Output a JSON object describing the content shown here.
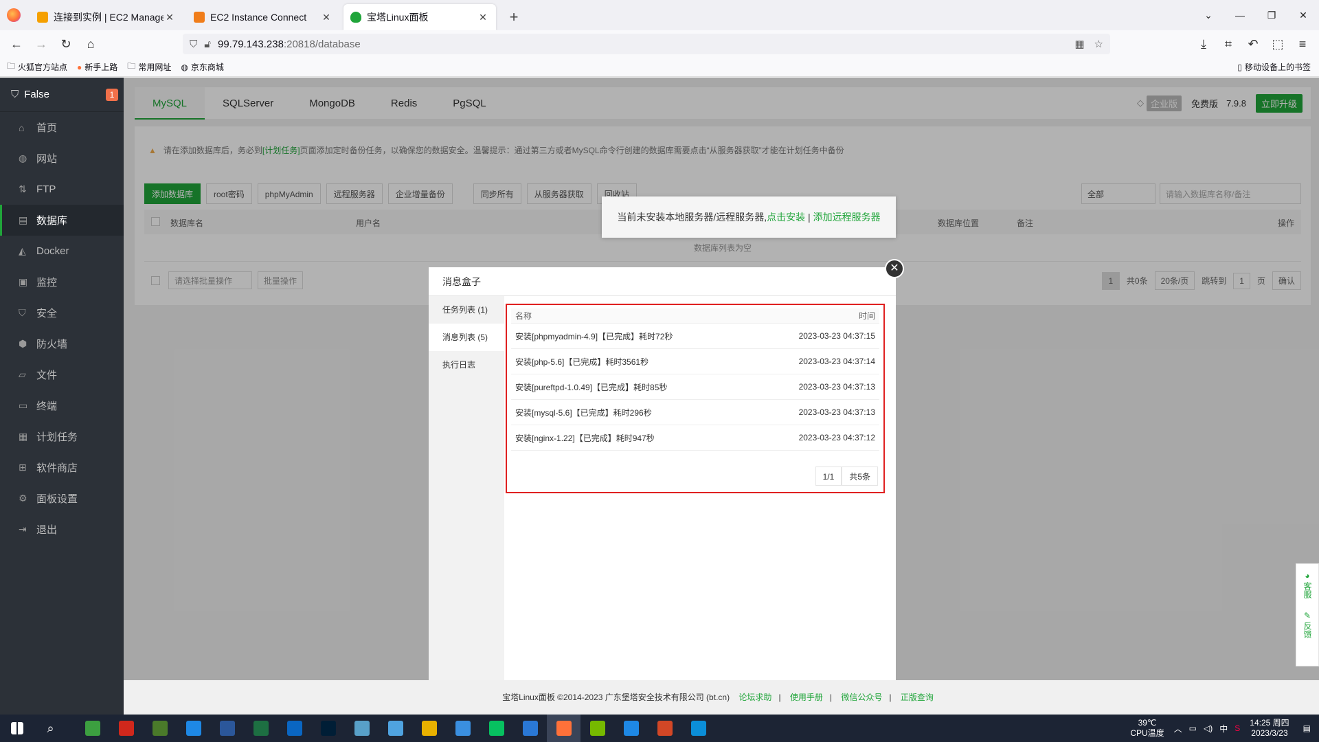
{
  "browser": {
    "tabs": [
      {
        "title": "连接到实例 | EC2 Managemen",
        "color": "#f5a000"
      },
      {
        "title": "EC2 Instance Connect",
        "color": "#f07d1a"
      },
      {
        "title": "宝塔Linux面板",
        "color": "#20a53a"
      }
    ],
    "url_host": "99.79.143.238",
    "url_path": ":20818/database",
    "bookmarks": [
      "火狐官方站点",
      "新手上路",
      "常用网址",
      "京东商城"
    ],
    "mobile_bookmarks": "移动设备上的书签"
  },
  "sidebar": {
    "title": "False",
    "badge": "1",
    "items": [
      {
        "label": "首页",
        "icon": "⌂"
      },
      {
        "label": "网站",
        "icon": "◍"
      },
      {
        "label": "FTP",
        "icon": "⇅"
      },
      {
        "label": "数据库",
        "icon": "▤"
      },
      {
        "label": "Docker",
        "icon": "◭"
      },
      {
        "label": "监控",
        "icon": "▣"
      },
      {
        "label": "安全",
        "icon": "⛉"
      },
      {
        "label": "防火墙",
        "icon": "⬢"
      },
      {
        "label": "文件",
        "icon": "▱"
      },
      {
        "label": "终端",
        "icon": "▭"
      },
      {
        "label": "计划任务",
        "icon": "▦"
      },
      {
        "label": "软件商店",
        "icon": "⊞"
      },
      {
        "label": "面板设置",
        "icon": "⚙"
      },
      {
        "label": "退出",
        "icon": "⇥"
      }
    ]
  },
  "db_tabs": [
    "MySQL",
    "SQLServer",
    "MongoDB",
    "Redis",
    "PgSQL"
  ],
  "edition": {
    "enterprise": "企业版",
    "free": "免费版",
    "version": "7.9.8",
    "upgrade": "立即升级"
  },
  "warning": {
    "pre": "请在添加数据库后，务必到",
    "link": "[计划任务]",
    "post": "页面添加定时备份任务，以确保您的数据安全。温馨提示：通过第三方或者MySQL命令行创建的数据库需要点击“从服务器获取”才能在计划任务中备份"
  },
  "buttons": [
    "添加数据库",
    "root密码",
    "phpMyAdmin",
    "远程服务器",
    "企业增量备份",
    "同步所有",
    "从服务器获取",
    "回收站"
  ],
  "filter": {
    "select": "全部",
    "search_placeholder": "请输入数据库名称/备注"
  },
  "table_headers": [
    "数据库名",
    "用户名",
    "数据库位置",
    "备注",
    "操作"
  ],
  "empty_text": "数据库列表为空",
  "batch": {
    "select": "请选择批量操作",
    "btn": "批量操作"
  },
  "pager": {
    "page": "1",
    "total": "共0条",
    "per": "20条/页",
    "jump": "跳转到",
    "page_num": "1",
    "page_unit": "页",
    "confirm": "确认"
  },
  "tip": {
    "text": "当前未安装本地服务器/远程服务器,",
    "install": "点击安装",
    "sep": " | ",
    "remote": "添加远程服务器"
  },
  "modal": {
    "title": "消息盒子",
    "nav": [
      "任务列表 (1)",
      "消息列表 (5)",
      "执行日志"
    ],
    "col_name": "名称",
    "col_time": "时间",
    "rows": [
      {
        "name": "安装[phpmyadmin-4.9]【已完成】耗时72秒",
        "time": "2023-03-23 04:37:15"
      },
      {
        "name": "安装[php-5.6]【已完成】耗时3561秒",
        "time": "2023-03-23 04:37:14"
      },
      {
        "name": "安装[pureftpd-1.0.49]【已完成】耗时85秒",
        "time": "2023-03-23 04:37:13"
      },
      {
        "name": "安装[mysql-5.6]【已完成】耗时296秒",
        "time": "2023-03-23 04:37:13"
      },
      {
        "name": "安装[nginx-1.22]【已完成】耗时947秒",
        "time": "2023-03-23 04:37:12"
      }
    ],
    "page": "1/1",
    "total": "共5条"
  },
  "footer": {
    "copyright": "宝塔Linux面板 ©2014-2023 广东堡塔安全技术有限公司 (bt.cn)",
    "links": [
      "论坛求助",
      "使用手册",
      "微信公众号",
      "正版查询"
    ]
  },
  "float": {
    "service": "客服",
    "feedback": "反馈"
  },
  "taskbar": {
    "temp": "39℃",
    "temp_label": "CPU温度",
    "ime": "中",
    "time": "14:25 周四",
    "date": "2023/3/23",
    "apps": [
      "#3c9f40",
      "#d0281c",
      "#4a7a2a",
      "#1e88e5",
      "#2b579a",
      "#1d6f42",
      "#0a66c2",
      "#001e36",
      "#58a0c8",
      "#4fa3e0",
      "#e8b100",
      "#3a8fe0",
      "#07c160",
      "#2a78d6",
      "#ff7139",
      "#76b900",
      "#1e88e5",
      "#d24726",
      "#0b8ed8"
    ]
  }
}
